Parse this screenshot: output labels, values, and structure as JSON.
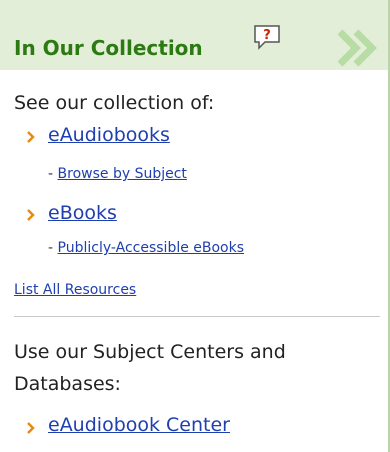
{
  "header": {
    "title": "In Our Collection",
    "help_icon": "help-question-icon",
    "chevron_icon": "double-chevron-right-icon",
    "background": "#e3eed8",
    "title_color": "#2c7a12"
  },
  "section1": {
    "intro": "See our collection of:",
    "items": [
      {
        "label": "eAudiobooks",
        "sub_prefix": "- ",
        "sub_label": "Browse by Subject"
      },
      {
        "label": "eBooks",
        "sub_prefix": "- ",
        "sub_label": "Publicly-Accessible eBooks"
      }
    ],
    "list_all": "List All Resources"
  },
  "section2": {
    "intro": "Use our Subject Centers and Databases:",
    "items": [
      {
        "label": "eAudiobook Center"
      }
    ]
  },
  "colors": {
    "link": "#1f3fae",
    "bullet": "#e88a12",
    "border": "#b8d4a8"
  }
}
